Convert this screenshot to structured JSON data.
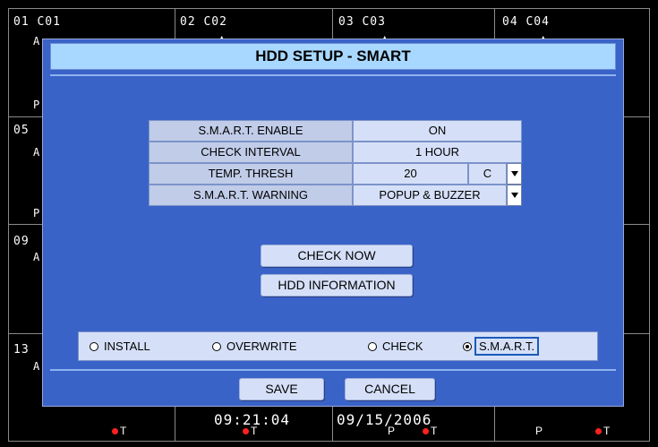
{
  "grid": {
    "cameras": [
      "01 C01",
      "02 C02",
      "03 C03",
      "04 C04"
    ],
    "side_labels": [
      "05",
      "09",
      "13"
    ],
    "left_letters": [
      "A",
      "P",
      "A",
      "P",
      "A",
      "A"
    ],
    "bottom_marks": [
      "T",
      "T",
      "P",
      "T",
      "P",
      "T"
    ],
    "time": "09:21:04",
    "date": "09/15/2006"
  },
  "dialog": {
    "title": "HDD SETUP - SMART",
    "rows": [
      {
        "label": "S.M.A.R.T. ENABLE",
        "value": "ON"
      },
      {
        "label": "CHECK INTERVAL",
        "value": "1 HOUR"
      },
      {
        "label": "TEMP. THRESH",
        "value": "20",
        "unit": "C"
      },
      {
        "label": "S.M.A.R.T. WARNING",
        "value": "POPUP & BUZZER"
      }
    ],
    "buttons": {
      "check_now": "CHECK NOW",
      "hdd_info": "HDD INFORMATION"
    },
    "modes": [
      {
        "label": "INSTALL",
        "selected": false
      },
      {
        "label": "OVERWRITE",
        "selected": false
      },
      {
        "label": "CHECK",
        "selected": false
      },
      {
        "label": "S.M.A.R.T.",
        "selected": true
      }
    ],
    "save": "SAVE",
    "cancel": "CANCEL"
  }
}
